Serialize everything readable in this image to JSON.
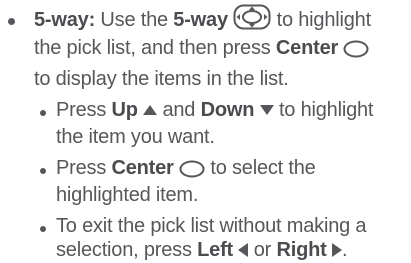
{
  "main_item": {
    "lead_label": "5-way:",
    "t1": " Use the ",
    "b1": "5-way",
    "t2": " to highlight",
    "line2": "the pick list, and then press ",
    "b2": "Center",
    "line3": "to display the items in the list."
  },
  "sub_items": [
    {
      "t1": "Press ",
      "b1": "Up",
      "b2": "Down",
      "t2": " to highlight",
      "line2": "the item you want."
    },
    {
      "t1": "Press ",
      "b1": "Center",
      "t2": " to select the",
      "line2": "highlighted item."
    },
    {
      "line1": "To exit the pick list without making a",
      "t1": "selection, press ",
      "b1": "Left",
      "mid": " or ",
      "b2": "Right",
      "end": "."
    }
  ],
  "icons": {
    "five_way": "five-way-navigator-icon",
    "center": "center-button-icon",
    "up": "up-arrow-icon",
    "down": "down-arrow-icon",
    "left": "left-arrow-icon",
    "right": "right-arrow-icon"
  },
  "colors": {
    "text": "#55575a",
    "bold_text": "#4a4c4f"
  }
}
